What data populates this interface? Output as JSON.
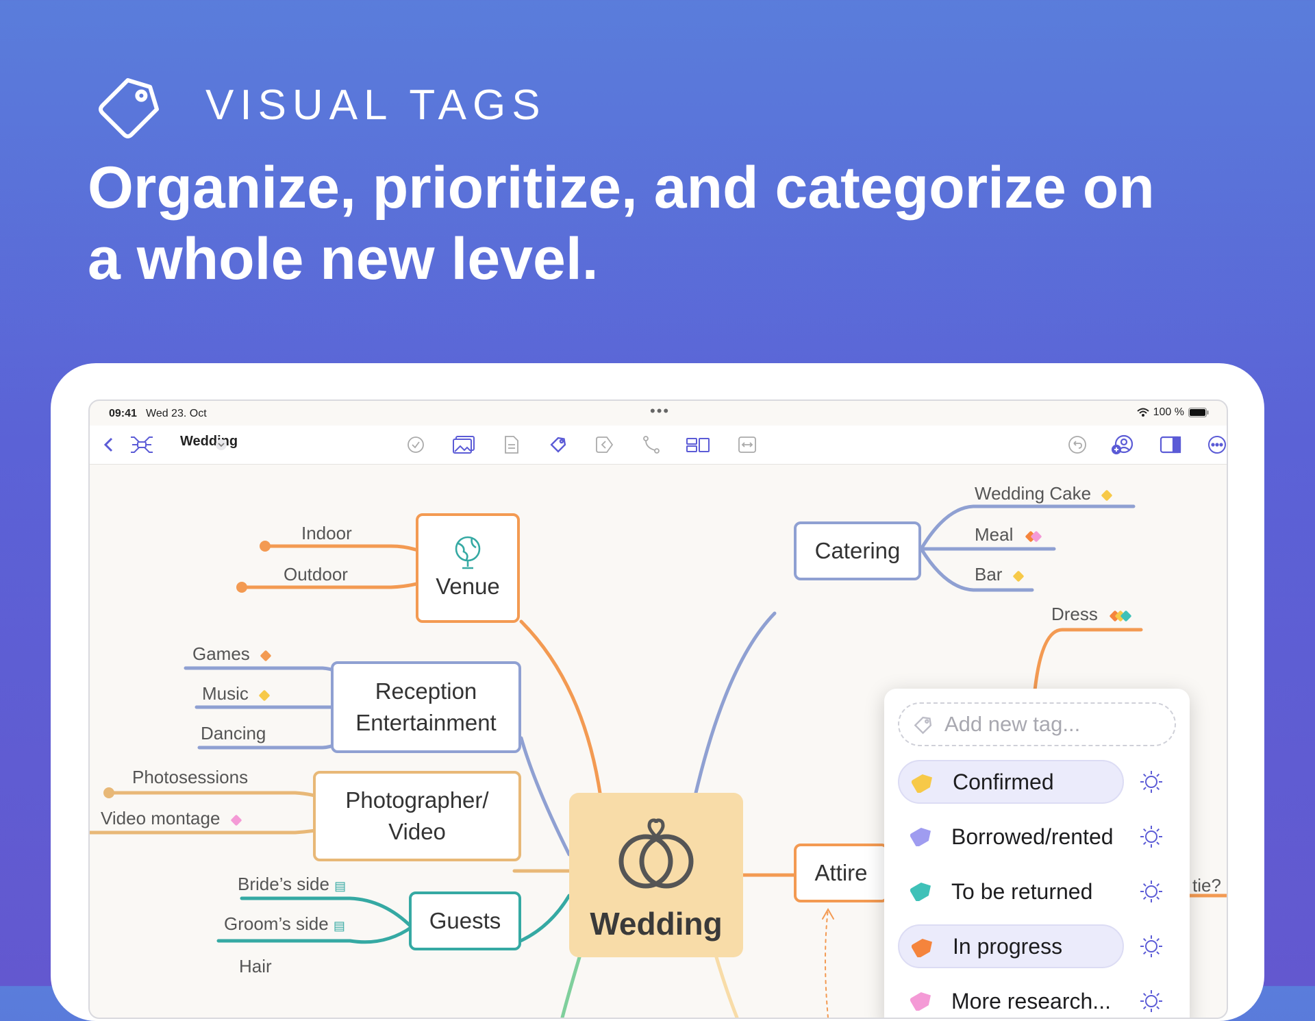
{
  "hero": {
    "eyebrow": "VISUAL TAGS",
    "headline": "Organize, prioritize, and categorize on a whole new level.",
    "icon": "tag-icon"
  },
  "status": {
    "time": "09:41",
    "date": "Wed 23. Oct",
    "battery": "100 %"
  },
  "toolbar": {
    "title": "Wedding"
  },
  "map": {
    "center": "Wedding",
    "venue": "Venue",
    "venue_leaves": [
      "Indoor",
      "Outdoor"
    ],
    "reception_line1": "Reception",
    "reception_line2": "Entertainment",
    "reception_leaves": [
      "Games",
      "Music",
      "Dancing"
    ],
    "photo_line1": "Photographer/",
    "photo_line2": "Video",
    "photo_leaves": [
      "Photosessions",
      "Video montage"
    ],
    "guests": "Guests",
    "guests_leaves": [
      "Bride’s side",
      "Groom’s side"
    ],
    "hair": "Hair",
    "catering": "Catering",
    "catering_leaves": [
      "Wedding Cake",
      "Meal",
      "Bar"
    ],
    "attire": "Attire",
    "dress": "Dress",
    "tie": "tie?"
  },
  "tag_popup": {
    "placeholder": "Add new tag...",
    "tags": [
      {
        "label": "Confirmed",
        "color": "#f7c948",
        "selected": true
      },
      {
        "label": "Borrowed/rented",
        "color": "#9f9cf0",
        "selected": false
      },
      {
        "label": "To be returned",
        "color": "#3fc1b8",
        "selected": false
      },
      {
        "label": "In progress",
        "color": "#f5843c",
        "selected": true
      },
      {
        "label": "More research...",
        "color": "#f49ad6",
        "selected": false
      }
    ]
  },
  "colors": {
    "orange": "#f39a52",
    "blue": "#8fa0d2",
    "tan": "#e8b877",
    "teal": "#35a9a3",
    "green": "#7fcf9c",
    "accent": "#5b5bd6"
  }
}
